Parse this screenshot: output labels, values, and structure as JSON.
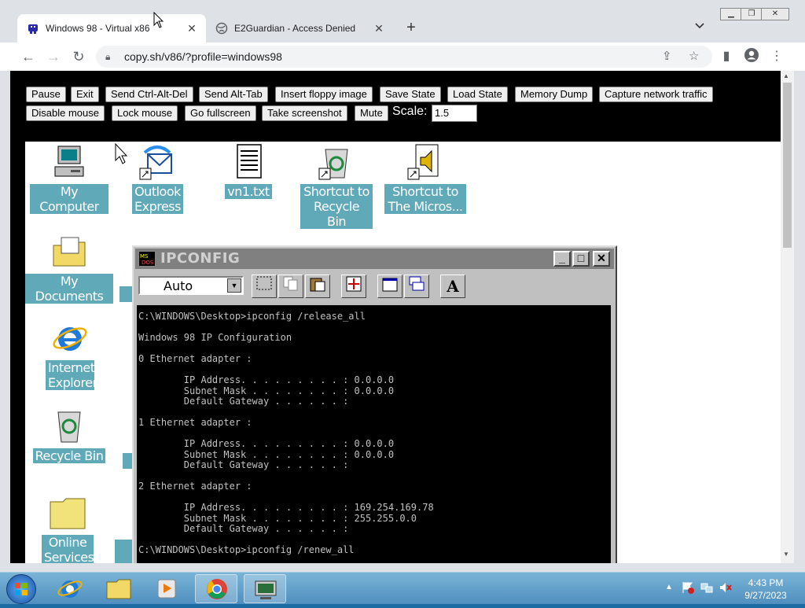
{
  "browser": {
    "tabs": [
      {
        "title": "Windows 98 - Virtual x86",
        "active": true
      },
      {
        "title": "E2Guardian - Access Denied",
        "active": false
      }
    ],
    "url": "copy.sh/v86/?profile=windows98"
  },
  "v86_controls": {
    "row1": [
      "Pause",
      "Exit",
      "Send Ctrl-Alt-Del",
      "Send Alt-Tab",
      "Insert floppy image",
      "Save State",
      "Load State",
      "Memory Dump",
      "Capture network traffic"
    ],
    "row2": [
      "Disable mouse",
      "Lock mouse",
      "Go fullscreen",
      "Take screenshot",
      "Mute"
    ],
    "scale_label": "Scale:",
    "scale_value": "1.5"
  },
  "desktop_icons": [
    {
      "label": "My Computer"
    },
    {
      "label": "Outlook Express"
    },
    {
      "label": "vn1.txt"
    },
    {
      "label": "Shortcut to Recycle Bin"
    },
    {
      "label": "Shortcut to The Micros..."
    },
    {
      "label": "My Documents"
    },
    {
      "label": "Internet Explorer"
    },
    {
      "label": "Recycle Bin"
    },
    {
      "label": "Online Services"
    }
  ],
  "ipconfig_window": {
    "title": "IPCONFIG",
    "font_select": "Auto",
    "console_lines": [
      "C:\\WINDOWS\\Desktop>ipconfig /release_all",
      "",
      "Windows 98 IP Configuration",
      "",
      "0 Ethernet adapter :",
      "",
      "        IP Address. . . . . . . . . : 0.0.0.0",
      "        Subnet Mask . . . . . . . . : 0.0.0.0",
      "        Default Gateway . . . . . . :",
      "",
      "1 Ethernet adapter :",
      "",
      "        IP Address. . . . . . . . . : 0.0.0.0",
      "        Subnet Mask . . . . . . . . : 0.0.0.0",
      "        Default Gateway . . . . . . :",
      "",
      "2 Ethernet adapter :",
      "",
      "        IP Address. . . . . . . . . : 169.254.169.78",
      "        Subnet Mask . . . . . . . . : 255.255.0.0",
      "        Default Gateway . . . . . . :",
      "",
      "C:\\WINDOWS\\Desktop>ipconfig /renew_all"
    ]
  },
  "taskbar": {
    "time": "4:43 PM",
    "date": "9/27/2023"
  }
}
